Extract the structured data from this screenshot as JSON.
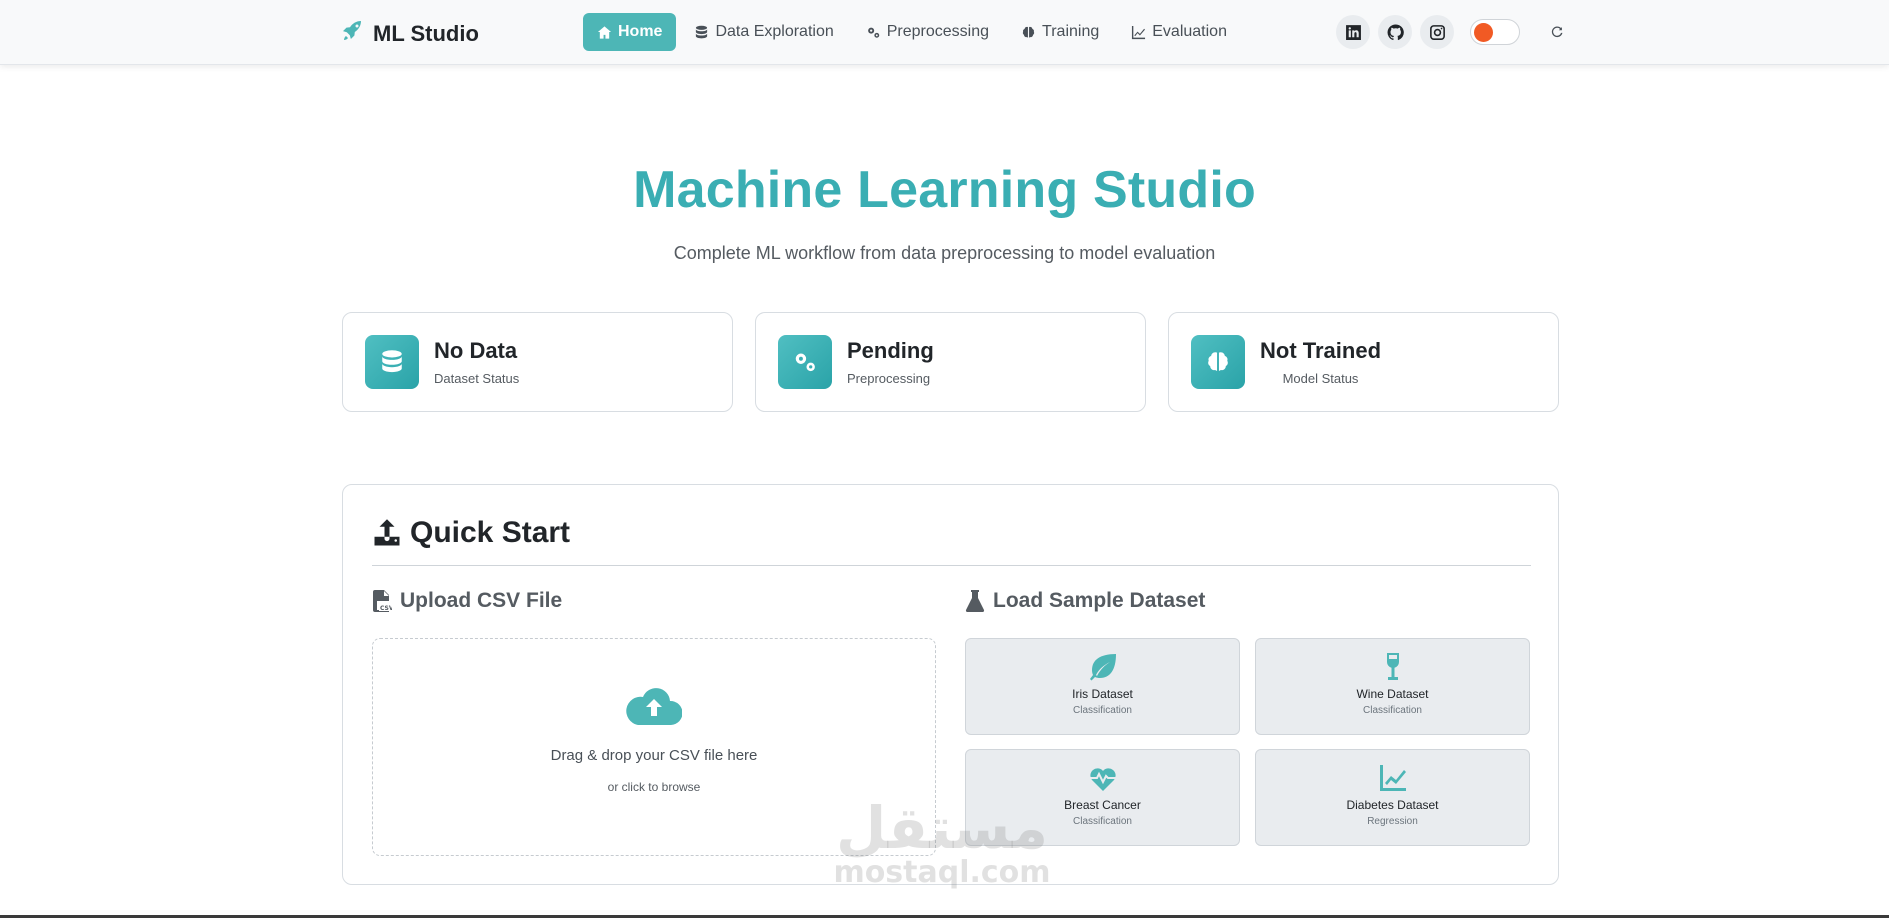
{
  "brand": {
    "name": "ML Studio",
    "icon": "rocket-icon"
  },
  "nav": {
    "items": [
      {
        "label": "Home",
        "icon": "home-icon",
        "active": true
      },
      {
        "label": "Data Exploration",
        "icon": "database-icon",
        "active": false
      },
      {
        "label": "Preprocessing",
        "icon": "cogs-icon",
        "active": false
      },
      {
        "label": "Training",
        "icon": "brain-icon",
        "active": false
      },
      {
        "label": "Evaluation",
        "icon": "chart-line-icon",
        "active": false
      }
    ],
    "social": [
      "linkedin-icon",
      "github-icon",
      "instagram-icon"
    ],
    "toggle_color": "#f15a24"
  },
  "hero": {
    "title": "Machine Learning Studio",
    "subtitle": "Complete ML workflow from data preprocessing to model evaluation"
  },
  "stats": [
    {
      "value": "No Data",
      "label": "Dataset Status",
      "icon": "database-icon"
    },
    {
      "value": "Pending",
      "label": "Preprocessing",
      "icon": "cogs-icon"
    },
    {
      "value": "Not Trained",
      "label": "Model Status",
      "icon": "brain-icon"
    }
  ],
  "quick_start": {
    "title": "Quick Start",
    "upload": {
      "title": "Upload CSV File",
      "drop_text": "Drag & drop your CSV file here",
      "browse_text": "or click to browse"
    },
    "samples": {
      "title": "Load Sample Dataset",
      "datasets": [
        {
          "name": "Iris Dataset",
          "type": "Classification",
          "icon": "leaf-icon"
        },
        {
          "name": "Wine Dataset",
          "type": "Classification",
          "icon": "wine-glass-icon"
        },
        {
          "name": "Breast Cancer",
          "type": "Classification",
          "icon": "heartbeat-icon"
        },
        {
          "name": "Diabetes Dataset",
          "type": "Regression",
          "icon": "chart-line-icon"
        }
      ]
    }
  },
  "watermark": {
    "arabic": "مستقل",
    "latin": "mostaql.com"
  },
  "colors": {
    "accent": "#4db6b6",
    "title": "#3aaeb3"
  }
}
